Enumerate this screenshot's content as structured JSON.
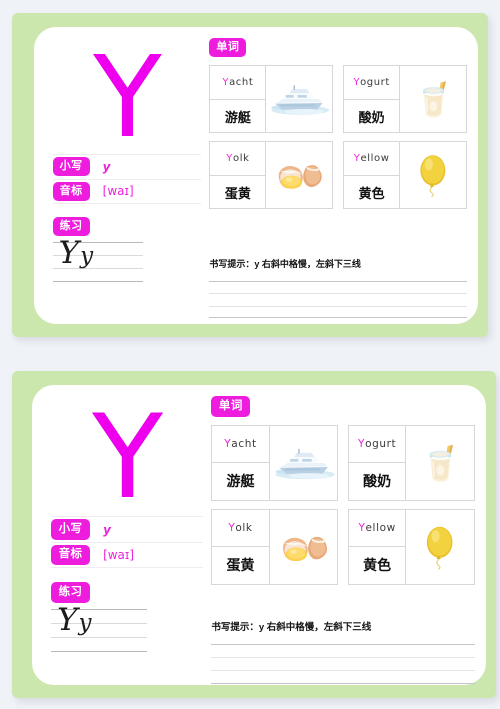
{
  "theme": {
    "page_bg": "#eff2f7",
    "frame_green": "#cbe7ad",
    "card_white": "#ffffff",
    "accent_magenta": "#ee1ddd",
    "letter_color": "#ee00ee"
  },
  "card": {
    "big_letter": "Y",
    "lowercase_pill": "小写",
    "lowercase_value": "y",
    "phonetic_pill": "音标",
    "phonetic_value": "[waɪ]",
    "practice_pill": "练习",
    "words_pill": "单词",
    "hint": "书写提示：y 右斜中格慢，左斜下三线",
    "handwriting_upper": "Y",
    "handwriting_lower": "y",
    "words": [
      {
        "initial": "Y",
        "rest": "acht",
        "en": "Yacht",
        "cn": "游艇",
        "icon": "yacht-boat-image"
      },
      {
        "initial": "Y",
        "rest": "ogurt",
        "en": "Yogurt",
        "cn": "酸奶",
        "icon": "yogurt-jar-image"
      },
      {
        "initial": "Y",
        "rest": "olk",
        "en": "Yolk",
        "cn": "蛋黄",
        "icon": "egg-yolk-image"
      },
      {
        "initial": "Y",
        "rest": "ellow",
        "en": "Yellow",
        "cn": "黄色",
        "icon": "yellow-balloon-image"
      }
    ]
  }
}
